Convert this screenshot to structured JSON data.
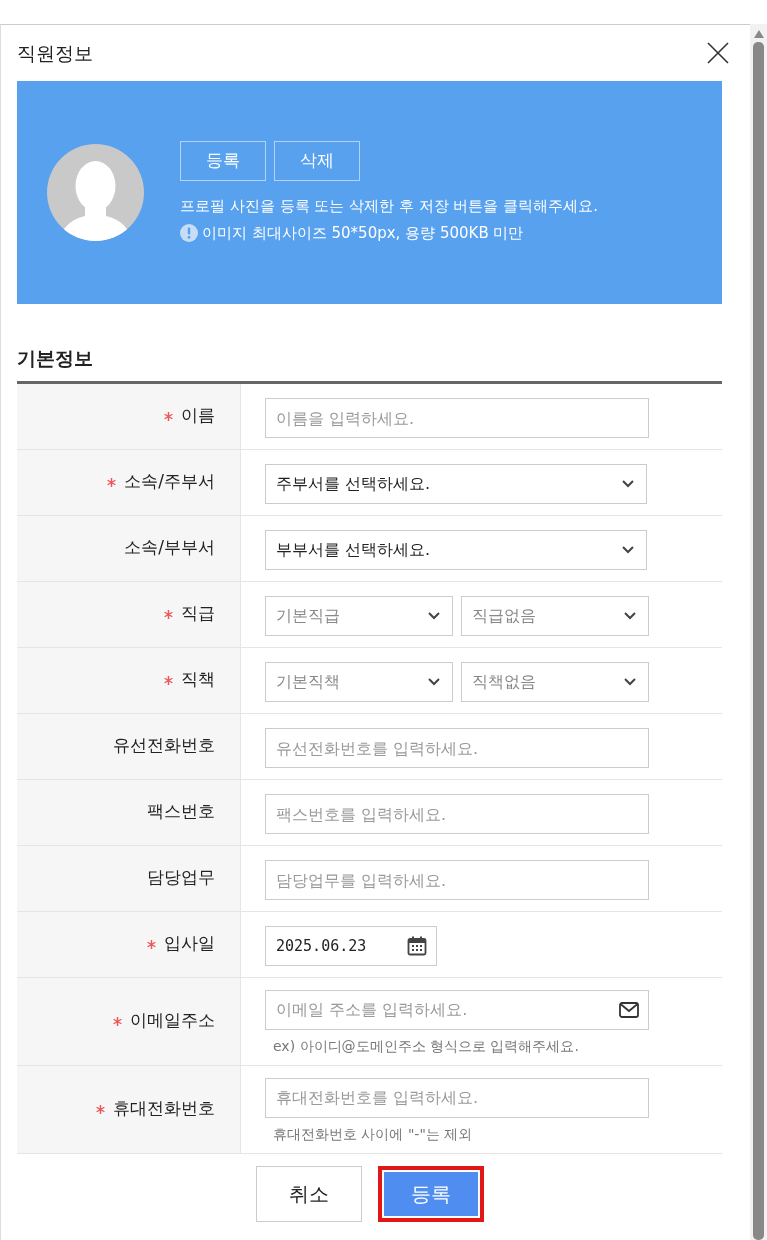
{
  "dialog": {
    "title": "직원정보"
  },
  "profile": {
    "buttons": [
      {
        "label": "등록"
      },
      {
        "label": "삭제"
      }
    ],
    "notice": "프로필 사진을 등록 또는 삭제한 후 저장 버튼을 클릭해주세요.",
    "info": "이미지 최대사이즈 50*50px, 용량 500KB 미만"
  },
  "section_title": "기본정보",
  "fields": [
    {
      "label": "이름",
      "required": true,
      "kind": "text",
      "placeholder": "이름을 입력하세요."
    },
    {
      "label": "소속/주부서",
      "required": true,
      "kind": "select",
      "selects": [
        {
          "value": "주부서를 선택하세요.",
          "dimmed": false
        }
      ]
    },
    {
      "label": "소속/부부서",
      "required": false,
      "kind": "select",
      "selects": [
        {
          "value": "부부서를 선택하세요.",
          "dimmed": false
        }
      ]
    },
    {
      "label": "직급",
      "required": true,
      "kind": "select",
      "selects": [
        {
          "value": "기본직급",
          "dimmed": true
        },
        {
          "value": "직급없음",
          "dimmed": true
        }
      ]
    },
    {
      "label": "직책",
      "required": true,
      "kind": "select",
      "selects": [
        {
          "value": "기본직책",
          "dimmed": true
        },
        {
          "value": "직책없음",
          "dimmed": true
        }
      ]
    },
    {
      "label": "유선전화번호",
      "required": false,
      "kind": "text",
      "placeholder": "유선전화번호를 입력하세요."
    },
    {
      "label": "팩스번호",
      "required": false,
      "kind": "text",
      "placeholder": "팩스번호를 입력하세요."
    },
    {
      "label": "담당업무",
      "required": false,
      "kind": "text",
      "placeholder": "담당업무를 입력하세요."
    },
    {
      "label": "입사일",
      "required": true,
      "kind": "date",
      "value": "2025.06.23"
    },
    {
      "label": "이메일주소",
      "required": true,
      "kind": "email",
      "placeholder": "이메일 주소를 입력하세요.",
      "hint": "ex) 아이디@도메인주소 형식으로 입력해주세요."
    },
    {
      "label": "휴대전화번호",
      "required": true,
      "kind": "text",
      "placeholder": "휴대전화번호를 입력하세요.",
      "hint": "휴대전화번호 사이에 \"-\"는 제외"
    }
  ],
  "actions": [
    {
      "label": "취소",
      "kind": "secondary",
      "highlighted": false
    },
    {
      "label": "등록",
      "kind": "primary",
      "highlighted": true
    }
  ]
}
